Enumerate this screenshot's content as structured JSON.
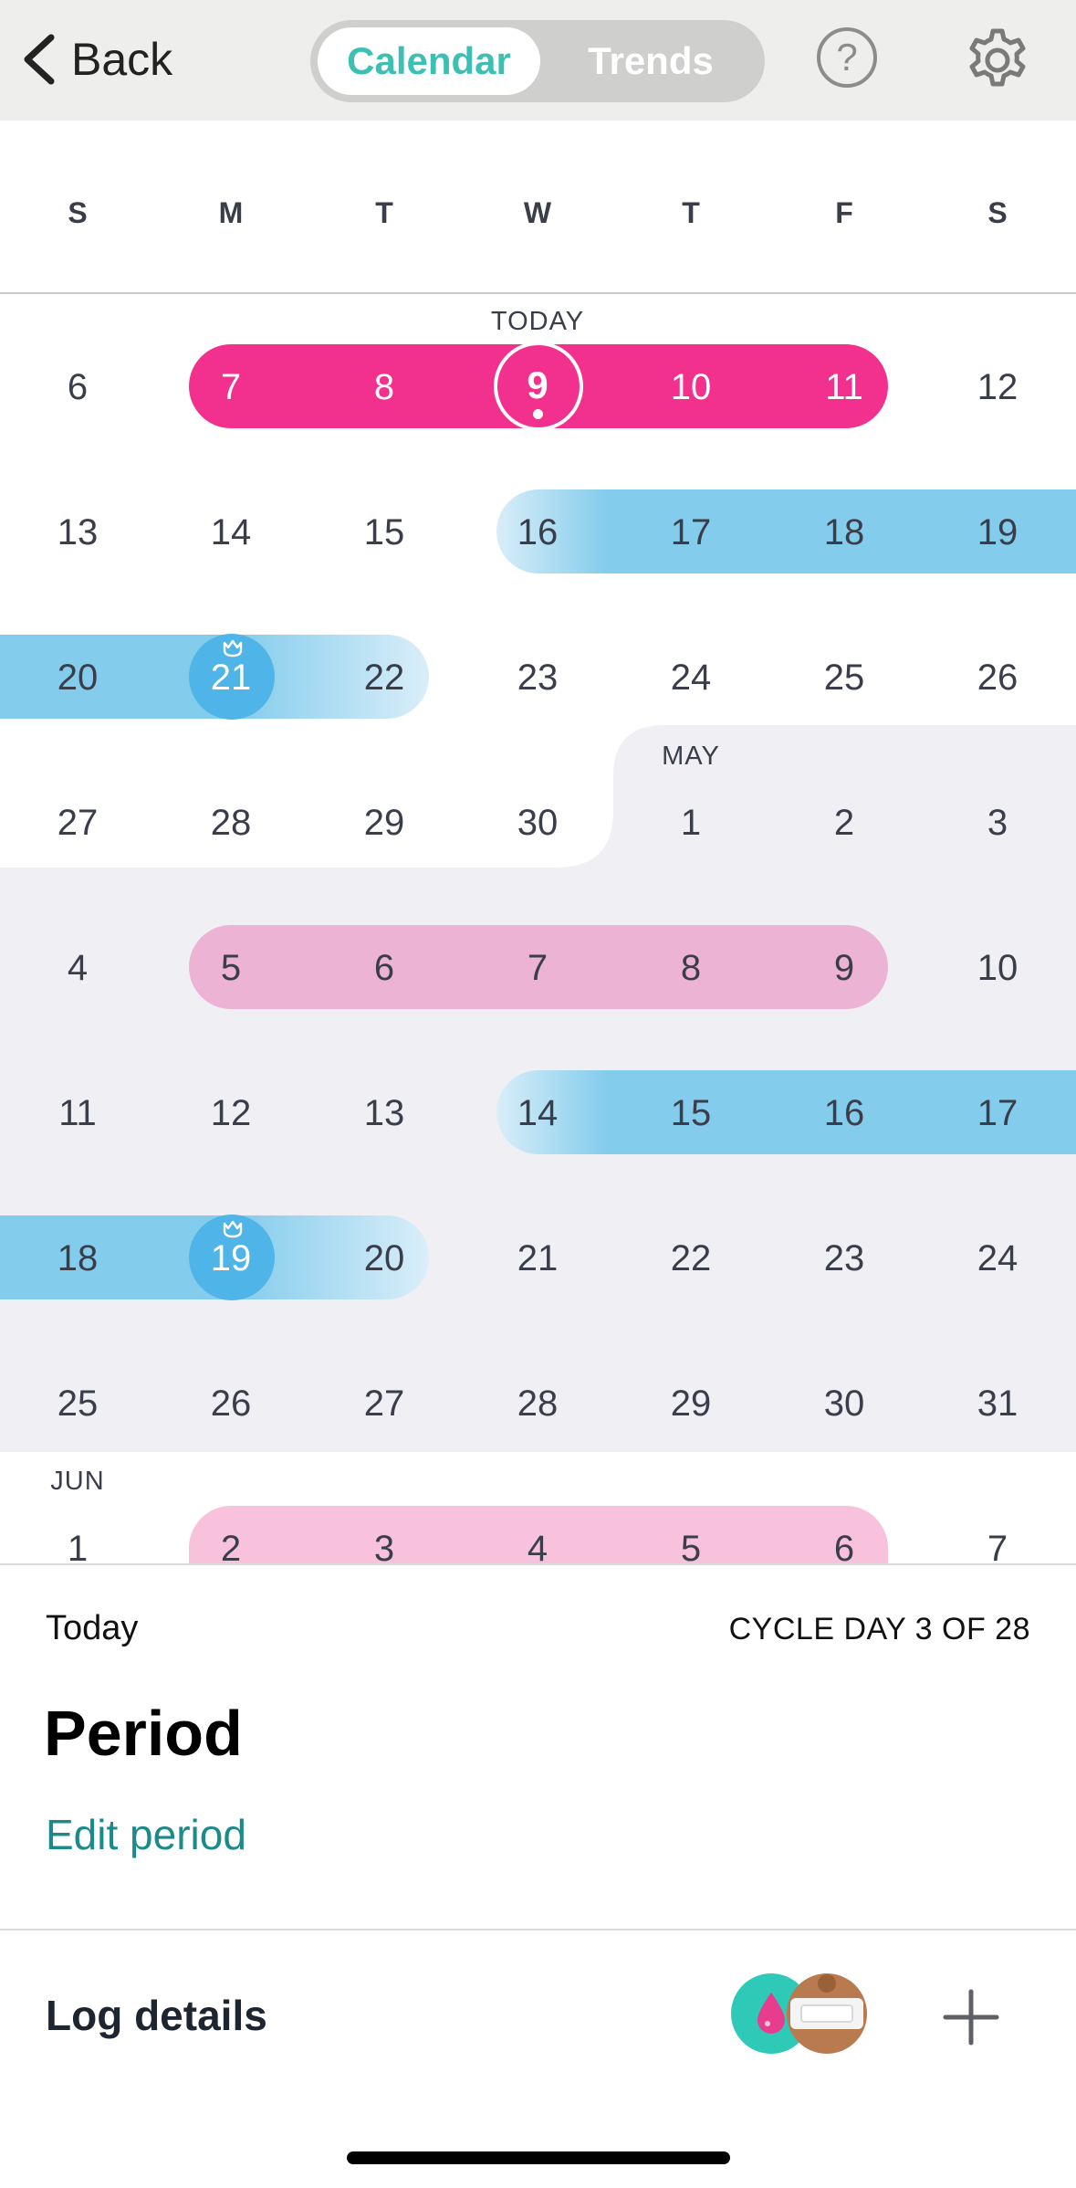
{
  "header": {
    "back_label": "Back",
    "tabs": [
      {
        "label": "Calendar",
        "selected": true
      },
      {
        "label": "Trends",
        "selected": false
      }
    ],
    "help_label": "?",
    "icons": [
      "back-chevron-icon",
      "help-icon",
      "gear-icon"
    ]
  },
  "weekdays": [
    "S",
    "M",
    "T",
    "W",
    "T",
    "F",
    "S"
  ],
  "calendar": {
    "today_label": "TODAY",
    "month_labels": {
      "may": "MAY",
      "jun": "JUN"
    },
    "rows": [
      [
        "6",
        "7",
        "8",
        "9",
        "10",
        "11",
        "12"
      ],
      [
        "13",
        "14",
        "15",
        "16",
        "17",
        "18",
        "19"
      ],
      [
        "20",
        "21",
        "22",
        "23",
        "24",
        "25",
        "26"
      ],
      [
        "27",
        "28",
        "29",
        "30",
        "1",
        "2",
        "3"
      ],
      [
        "4",
        "5",
        "6",
        "7",
        "8",
        "9",
        "10"
      ],
      [
        "11",
        "12",
        "13",
        "14",
        "15",
        "16",
        "17"
      ],
      [
        "18",
        "19",
        "20",
        "21",
        "22",
        "23",
        "24"
      ],
      [
        "25",
        "26",
        "27",
        "28",
        "29",
        "30",
        "31"
      ],
      [
        "1",
        "2",
        "3",
        "4",
        "5",
        "6",
        "7"
      ]
    ],
    "colors": {
      "period": "#f2318f",
      "predicted_period": "#edb3d4",
      "fertile": "#84ccec",
      "ovulation": "#4fb4e8",
      "future_month_bg": "#efeff4"
    }
  },
  "summary": {
    "today_label": "Today",
    "cycle_day": "CYCLE DAY 3 OF 28",
    "phase_title": "Period",
    "edit_link": "Edit period",
    "accent": "#1a8a8a"
  },
  "log": {
    "label": "Log details",
    "add_label": "+",
    "icons": [
      "period-drop-icon",
      "symptom-body-icon",
      "plus-icon"
    ]
  }
}
